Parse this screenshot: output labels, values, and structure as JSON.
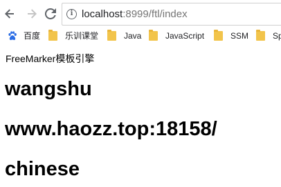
{
  "toolbar": {
    "back_icon": "arrow-left-icon",
    "forward_icon": "arrow-right-icon",
    "reload_icon": "reload-icon",
    "info_icon": "info-icon",
    "info_glyph": "i",
    "url_host": "localhost",
    "url_rest": ":8999/ftl/index"
  },
  "bookmarks": [
    {
      "label": "百度",
      "icon": "baidu-paw-icon"
    },
    {
      "label": "乐训课堂",
      "icon": "folder-icon"
    },
    {
      "label": "Java",
      "icon": "folder-icon"
    },
    {
      "label": "JavaScript",
      "icon": "folder-icon"
    },
    {
      "label": "SSM",
      "icon": "folder-icon"
    },
    {
      "label": "Sp",
      "icon": "folder-icon"
    }
  ],
  "page": {
    "caption": "FreeMarker模板引擎",
    "headings": [
      "wangshu",
      "www.haozz.top:18158/",
      "chinese"
    ]
  },
  "colors": {
    "folder": "#f2c44b",
    "baidu_paw": "#2b6de5",
    "text": "#000000",
    "url_muted": "#757575"
  }
}
